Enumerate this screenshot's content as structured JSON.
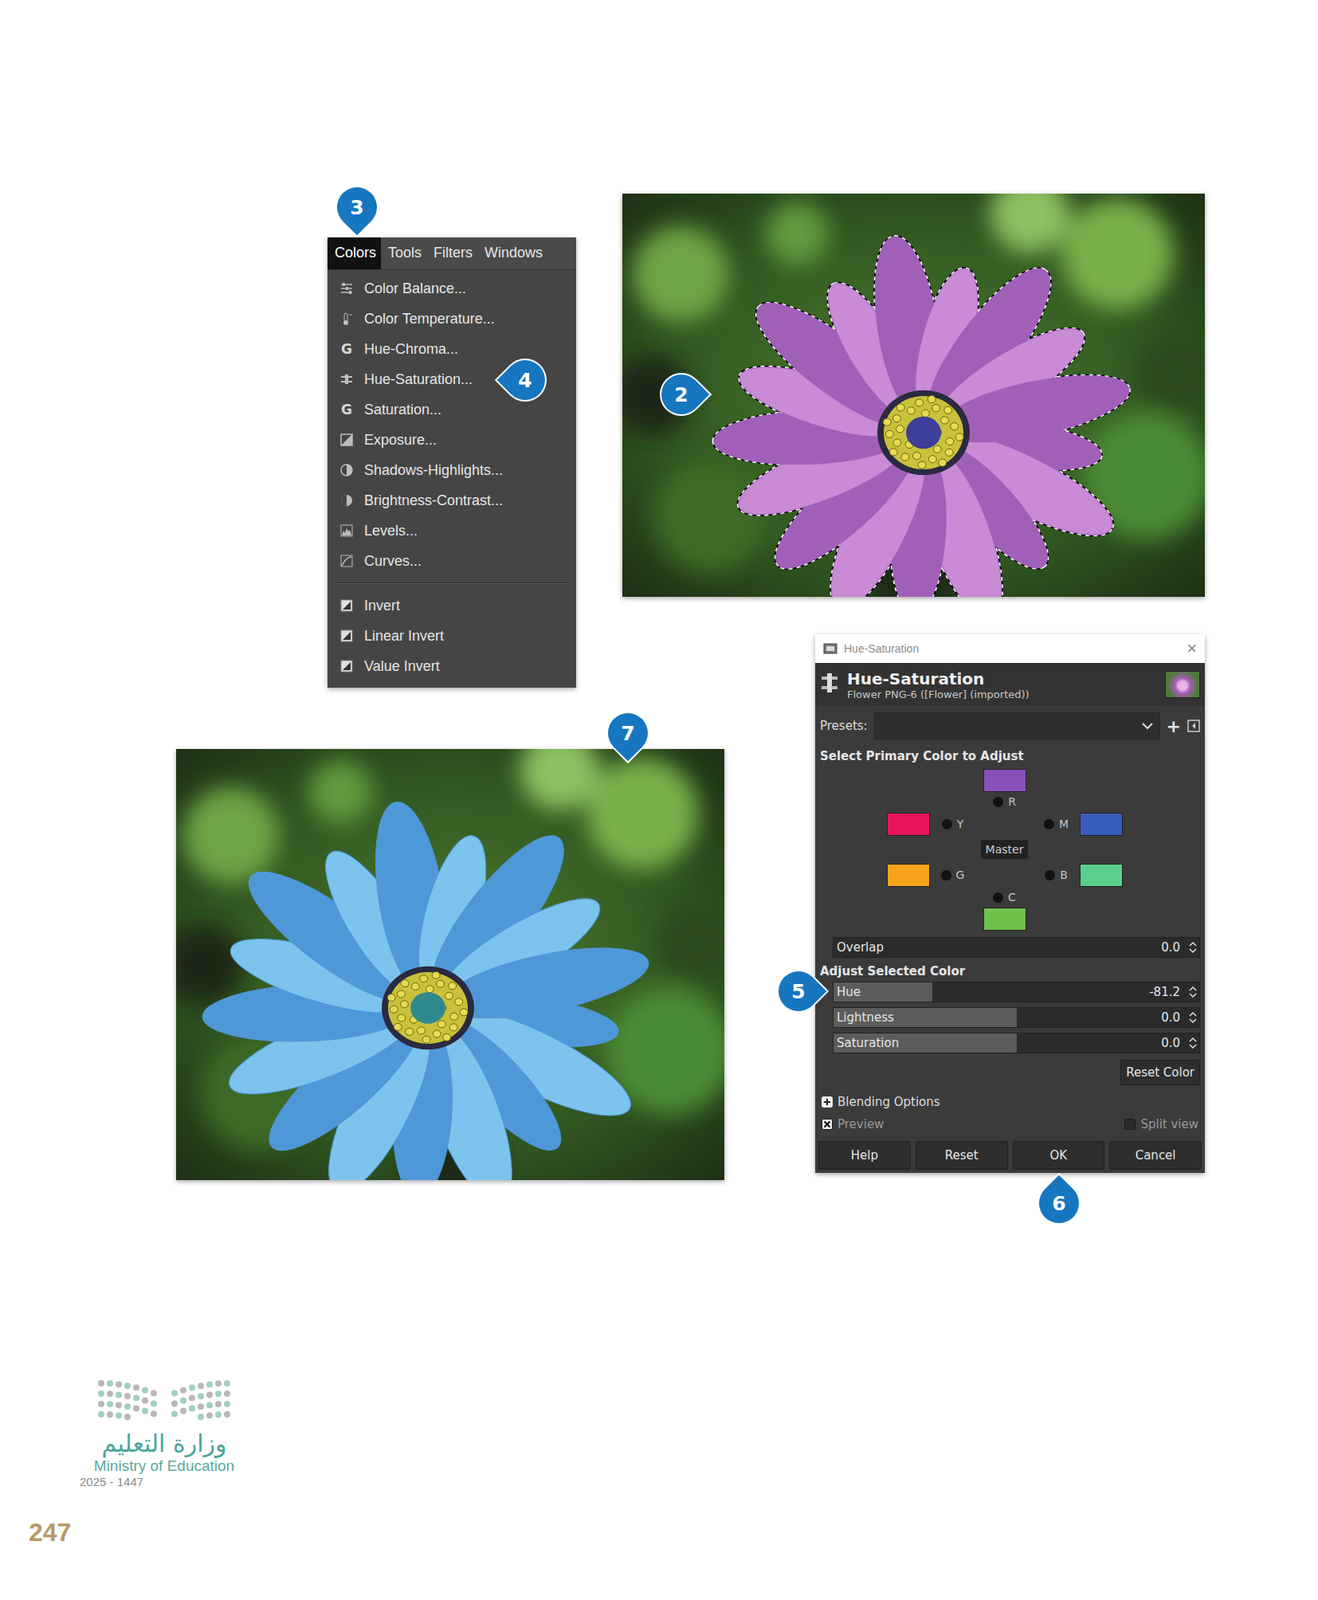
{
  "page": {
    "number": "247"
  },
  "logo": {
    "arabic": "وزارة التعليم",
    "english": "Ministry of Education",
    "year": "2025 - 1447"
  },
  "badges": [
    {
      "label": "3",
      "points": "down"
    },
    {
      "label": "2",
      "points": "right"
    },
    {
      "label": "4",
      "points": "left"
    },
    {
      "label": "7",
      "points": "down"
    },
    {
      "label": "5",
      "points": "right"
    },
    {
      "label": "6",
      "points": "up"
    }
  ],
  "menu": {
    "menubar": [
      {
        "label": "Colors",
        "selected": true
      },
      {
        "label": "Tools",
        "selected": false
      },
      {
        "label": "Filters",
        "selected": false
      },
      {
        "label": "Windows",
        "selected": false
      }
    ],
    "groups": [
      [
        {
          "label": "Color Balance..."
        },
        {
          "label": "Color Temperature..."
        },
        {
          "label": "Hue-Chroma...",
          "glyph": "G"
        },
        {
          "label": "Hue-Saturation..."
        },
        {
          "label": "Saturation...",
          "glyph": "G"
        },
        {
          "label": "Exposure..."
        },
        {
          "label": "Shadows-Highlights..."
        },
        {
          "label": "Brightness-Contrast..."
        },
        {
          "label": "Levels..."
        },
        {
          "label": "Curves..."
        }
      ],
      [
        {
          "label": "Invert"
        },
        {
          "label": "Linear Invert"
        },
        {
          "label": "Value Invert"
        }
      ]
    ]
  },
  "dialog": {
    "title": "Hue-Saturation",
    "close": "×",
    "heading": "Hue-Saturation",
    "subtitle": "Flower PNG-6 ([Flower] (imported))",
    "presets": {
      "label": "Presets:"
    },
    "add": "+",
    "primary_label": "Select Primary Color to Adjust",
    "primary_colors": [
      {
        "name": "R",
        "color": "#8b4fb8",
        "selected": false
      },
      {
        "name": "Y",
        "color": "#e8175d",
        "selected": false
      },
      {
        "name": "M",
        "color": "#3a5bbf",
        "selected": false
      },
      {
        "name": "G",
        "color": "#f6a31b",
        "selected": false
      },
      {
        "name": "B",
        "color": "#5bd08c",
        "selected": false
      },
      {
        "name": "C",
        "color": "#6fc14a",
        "selected": false
      }
    ],
    "master": {
      "label": "Master",
      "selected": true
    },
    "overlap": {
      "label": "Overlap",
      "value": "0.0",
      "level": 0
    },
    "adjust_label": "Adjust Selected Color",
    "sliders": [
      {
        "label": "Hue",
        "value": "-81.2",
        "level": 0.27
      },
      {
        "label": "Lightness",
        "value": "0.0",
        "level": 0.5
      },
      {
        "label": "Saturation",
        "value": "0.0",
        "level": 0.5
      }
    ],
    "reset_color": "Reset Color",
    "blending": "Blending Options",
    "preview": {
      "label": "Preview",
      "checked": true
    },
    "split_view": {
      "label": "Split view",
      "checked": false
    },
    "buttons": [
      "Help",
      "Reset",
      "OK",
      "Cancel"
    ]
  }
}
